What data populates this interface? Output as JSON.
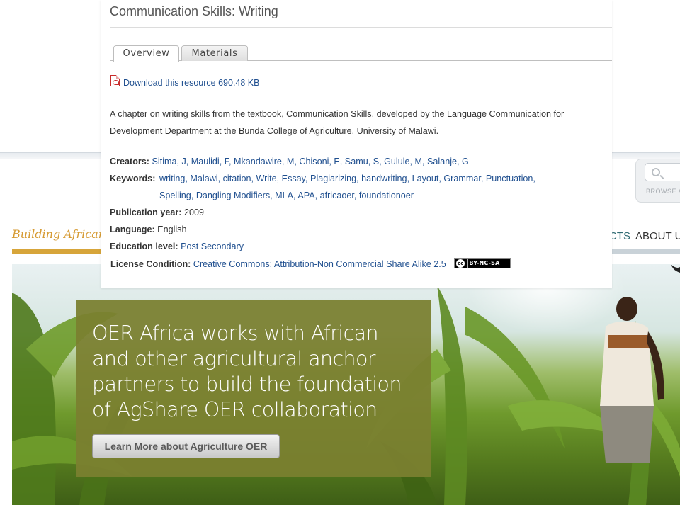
{
  "background": {
    "search": {
      "browse_label": "BROWSE A"
    },
    "tagline": "Building African",
    "nav": {
      "projects_fragment": "CTS",
      "about_fragment": "ABOUT U"
    },
    "hero": {
      "heading": "OER Africa works with African and other agricultural anchor partners to build the foundation of AgShare OER collaboration",
      "button_label": "Learn More about Agriculture OER"
    }
  },
  "resource": {
    "title": "Communication Skills: Writing",
    "tabs": [
      {
        "label": "Overview",
        "active": true
      },
      {
        "label": "Materials",
        "active": false
      }
    ],
    "download": {
      "icon": "pdf-icon",
      "label": "Download this resource 690.48 KB"
    },
    "description": "A chapter on writing skills from the textbook, Communication Skills, developed by the Language Communication for Development Department at the Bunda College of Agriculture, University of Malawi.",
    "creators_label": "Creators:",
    "creators": [
      "Sitima, J",
      "Maulidi, F",
      "Mkandawire, M",
      "Chisoni, E",
      "Samu, S",
      "Gulule, M",
      "Salanje, G"
    ],
    "keywords_label": "Keywords:",
    "keywords_line1": [
      "writing",
      "Malawi",
      "citation",
      "Write",
      "Essay",
      "Plagiarizing",
      "handwriting",
      "Layout",
      "Grammar",
      "Punctuation"
    ],
    "keywords_line2": [
      "Spelling",
      "Dangling Modifiers",
      "MLA",
      "APA",
      "africaoer",
      "foundationoer"
    ],
    "publication_year_label": "Publication year:",
    "publication_year": "2009",
    "language_label": "Language:",
    "language": "English",
    "education_level_label": "Education level:",
    "education_level": "Post Secondary",
    "license_label": "License Condition:",
    "license": "Creative Commons: Attribution-Non Commercial Share Alike 2.5",
    "license_badge": {
      "circle": "cc",
      "text": "BY-NC-SA"
    }
  },
  "colors": {
    "link": "#1f4f8f",
    "tagline": "#d69a31",
    "hero_panel": "#7a8030",
    "nav_accent": "#2e6a72"
  }
}
